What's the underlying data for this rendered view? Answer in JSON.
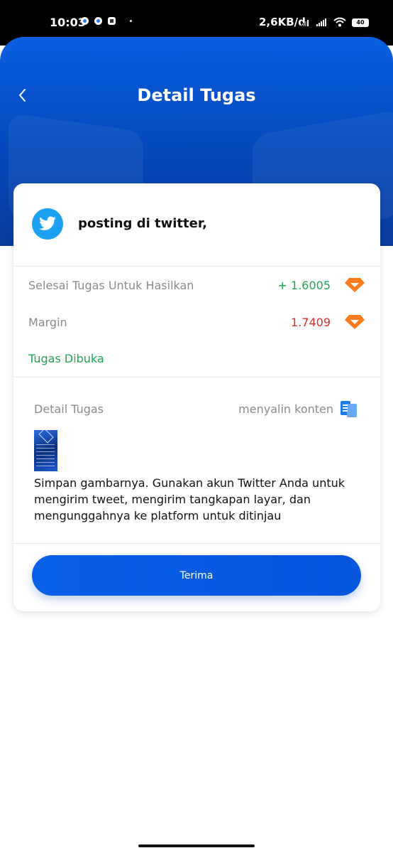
{
  "status_bar": {
    "time": "10:03",
    "net_speed": "2,6KB/d",
    "battery": "40"
  },
  "header": {
    "title": "Detail Tugas"
  },
  "task": {
    "name": "posting di twitter,",
    "reward_label": "Selesai Tugas Untuk Hasilkan",
    "reward_value": "+ 1.6005",
    "margin_label": "Margin",
    "margin_value": "1.7409",
    "status": "Tugas Dibuka"
  },
  "details": {
    "label": "Detail Tugas",
    "copy_label": "menyalin konten",
    "description": "Simpan gambarnya. Gunakan akun Twitter Anda untuk mengirim tweet, mengirim tangkapan layar, dan mengunggahnya ke platform untuk ditinjau"
  },
  "accept_button": {
    "label": "Terima"
  },
  "colors": {
    "primary": "#0a5fe4",
    "reward": "#1aa752",
    "margin": "#d32f2f",
    "gem": "#ff7a1a",
    "twitter": "#1da1f2"
  }
}
